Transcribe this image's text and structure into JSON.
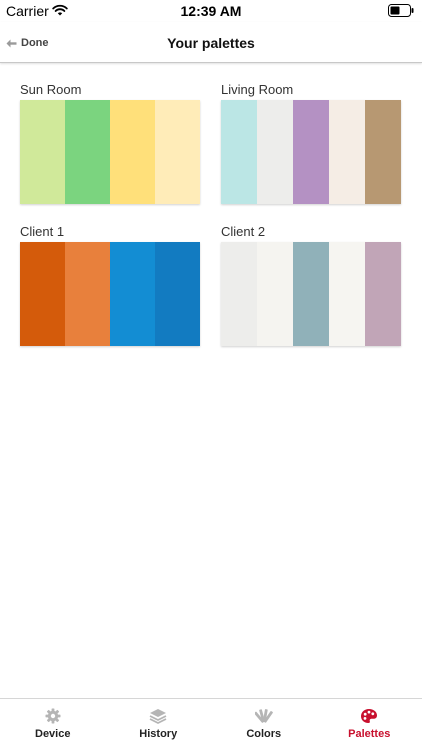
{
  "status_bar": {
    "carrier": "Carrier",
    "time": "12:39 AM"
  },
  "nav": {
    "done_label": "Done",
    "title": "Your palettes"
  },
  "palettes": [
    {
      "name": "Sun Room",
      "colors": [
        "#d0e99a",
        "#7bd47f",
        "#ffe07a",
        "#ffecb8"
      ]
    },
    {
      "name": "Living Room",
      "colors": [
        "#bbe6e5",
        "#ededeb",
        "#b491c3",
        "#f5ede5",
        "#b79872"
      ]
    },
    {
      "name": "Client 1",
      "colors": [
        "#d45b0b",
        "#e8803c",
        "#138dd3",
        "#127bc1"
      ]
    },
    {
      "name": "Client 2",
      "colors": [
        "#ededeb",
        "#f5f4f0",
        "#90b1b9",
        "#f6f5f1",
        "#c1a5b7"
      ]
    }
  ],
  "tabs": [
    {
      "label": "Device",
      "icon": "gear-icon",
      "active": false
    },
    {
      "label": "History",
      "icon": "stack-icon",
      "active": false
    },
    {
      "label": "Colors",
      "icon": "fan-deck-icon",
      "active": false
    },
    {
      "label": "Palettes",
      "icon": "palette-icon",
      "active": true
    }
  ],
  "colors": {
    "accent": "#c8102e",
    "inactive_icon": "#b5b5b5"
  }
}
